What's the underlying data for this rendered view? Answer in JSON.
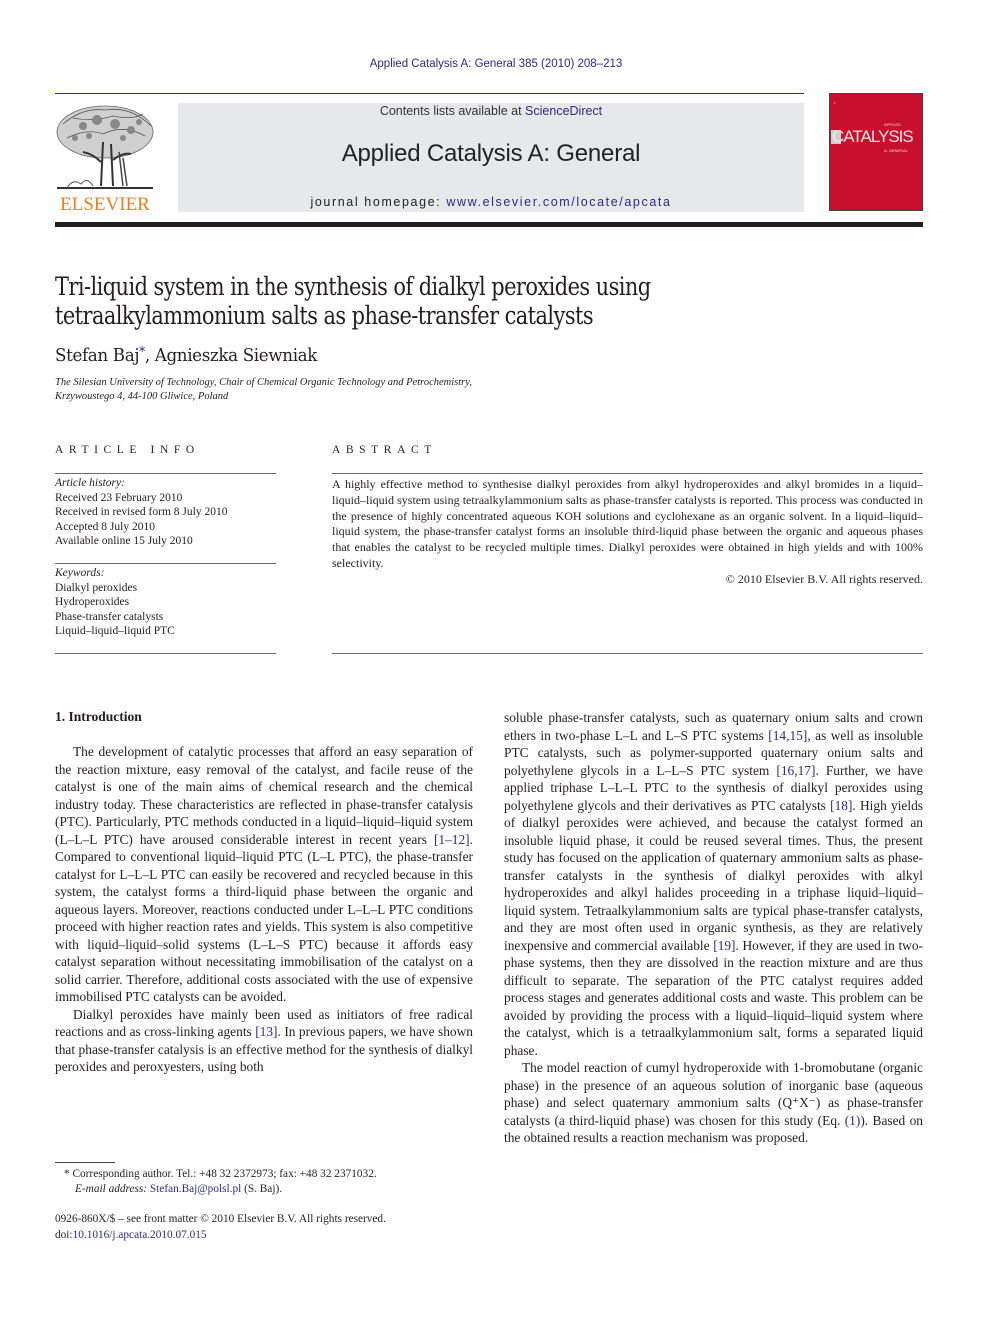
{
  "header": {
    "journal_ref": "Applied Catalysis A: General 385 (2010) 208–213",
    "contents_prefix": "Contents lists available at ",
    "contents_link": "ScienceDirect",
    "journal_title": "Applied Catalysis A: General",
    "homepage_prefix": "journal homepage: ",
    "homepage_link": "www.elsevier.com/locate/apcata",
    "publisher_logo_text": "ELSEVIER",
    "cover": {
      "title": "CATALYSIS",
      "top_small": "APPLIED",
      "sub_small": "A: GENERAL",
      "bg_color": "#c8102e"
    },
    "colors": {
      "link": "#2a2a8a",
      "elsevier_orange": "#f07d1a",
      "banner_bg": "#e7e8ea"
    }
  },
  "article": {
    "title_line1": "Tri-liquid system in the synthesis of dialkyl peroxides using",
    "title_line2": "tetraalkylammonium salts as phase-transfer catalysts",
    "author1": "Stefan Baj",
    "author1_mark": "*",
    "author_sep": ", ",
    "author2": "Agnieszka Siewniak",
    "affiliation_line1": "The Silesian University of Technology, Chair of Chemical Organic Technology and Petrochemistry,",
    "affiliation_line2": "Krzywoustego 4, 44-100 Gliwice, Poland"
  },
  "article_info": {
    "heading": "ARTICLE INFO",
    "history_label": "Article history:",
    "history": [
      "Received 23 February 2010",
      "Received in revised form 8 July 2010",
      "Accepted 8 July 2010",
      "Available online 15 July 2010"
    ],
    "keywords_label": "Keywords:",
    "keywords": [
      "Dialkyl peroxides",
      "Hydroperoxides",
      "Phase-transfer catalysts",
      "Liquid–liquid–liquid PTC"
    ]
  },
  "abstract": {
    "heading": "ABSTRACT",
    "text": "A highly effective method to synthesise dialkyl peroxides from alkyl hydroperoxides and alkyl bromides in a liquid–liquid–liquid system using tetraalkylammonium salts as phase-transfer catalysts is reported. This process was conducted in the presence of highly concentrated aqueous KOH solutions and cyclohex­ane as an organic solvent. In a liquid–liquid–liquid system, the phase-transfer catalyst forms an insoluble third-liquid phase between the organic and aqueous phases that enables the catalyst to be recycled multiple times. Dialkyl peroxides were obtained in high yields and with 100% selectivity.",
    "copyright": "© 2010 Elsevier B.V. All rights reserved."
  },
  "body": {
    "section_heading": "1.  Introduction",
    "p1_a": "The development of catalytic processes that afford an easy separation of the reaction mixture, easy removal of the catalyst, and facile reuse of the catalyst is one of the main aims of chemical research and the chemical industry today. These characteristics are reflected in phase-transfer catalysis (PTC). Particularly, PTC meth­ods conducted in a liquid–liquid–liquid system (L–L–L PTC) have aroused considerable interest in recent years ",
    "p1_ref1": "[1–12]",
    "p1_b": ". Compared to conventional liquid–liquid PTC (L–L PTC), the phase-transfer catalyst for L–L–L PTC can easily be recovered and recycled because in this system, the catalyst forms a third-liquid phase between the organic and aqueous layers. Moreover, reactions conducted under L–L–L PTC conditions proceed with higher reaction rates and yields. This system is also competitive with liquid–liquid–solid systems (L–L–S PTC) because it affords easy catalyst separation without necessitating immobilisation of the catalyst on a solid carrier. Therefore, additional costs associated with the use of expensive immobilised PTC catalysts can be avoided.",
    "p2_a": "Dialkyl peroxides have mainly been used as initiators of free rad­ical reactions and as cross-linking agents ",
    "p2_ref1": "[13]",
    "p2_b": ". In previous papers, we have shown that phase-transfer catalysis is an effective method for the synthesis of dialkyl peroxides and peroxyesters, using both ",
    "p2_c": "soluble phase-transfer catalysts, such as quaternary onium salts and crown ethers in two-phase L–L and L–S PTC systems ",
    "p2_ref2": "[14,15]",
    "p2_d": ", as well as insoluble PTC catalysts, such as polymer-supported quater­nary onium salts and polyethylene glycols in a L–L–S PTC system ",
    "p2_ref3": "[16,17]",
    "p2_e": ". Further, we have applied triphase L–L–L PTC to the syn­thesis of dialkyl peroxides using polyethylene glycols and their derivatives as PTC catalysts ",
    "p2_ref4": "[18]",
    "p2_f": ". High yields of dialkyl peroxides were achieved, and because the catalyst formed an insoluble liq­uid phase, it could be reused several times. Thus, the present study has focused on the application of quaternary ammonium salts as phase-transfer catalysts in the synthesis of dialkyl peroxides with alkyl hydroperoxides and alkyl halides proceeding in a triphase liquid–liquid–liquid system. Tetraalkylammonium salts are typical phase-transfer catalysts, and they are most often used in organic synthesis, as they are relatively inexpensive and commercial avail­able ",
    "p2_ref5": "[19]",
    "p2_g": ". However, if they are used in two-phase systems, then they are dissolved in the reaction mixture and are thus difficult to separate. The separation of the PTC catalyst requires added process stages and generates additional costs and waste. This problem can be avoided by providing the process with a liquid–liquid–liquid sys­tem where the catalyst, which is a tetraalkylammonium salt, forms a separated liquid phase.",
    "p3_a": "The model reaction of cumyl hydroperoxide with 1-bromobutane (organic phase) in the presence of an aqueous solution of inorganic base (aqueous phase) and select quaternary ammonium salts (Q⁺X⁻) as phase-transfer catalysts (a third-liquid phase) was chosen for this study (Eq. ",
    "p3_ref": "(1)",
    "p3_b": "). Based on the obtained results a reaction mechanism was proposed."
  },
  "footnote": {
    "mark": "*",
    "corresponding": " Corresponding author. Tel.: +48 32 2372973; fax: +48 32 2371032.",
    "email_label": "E-mail address: ",
    "email": "Stefan.Baj@polsl.pl",
    "email_suffix": " (S. Baj).",
    "front_matter": "0926-860X/$ – see front matter © 2010 Elsevier B.V. All rights reserved.",
    "doi_prefix": "doi:",
    "doi": "10.1016/j.apcata.2010.07.015"
  }
}
